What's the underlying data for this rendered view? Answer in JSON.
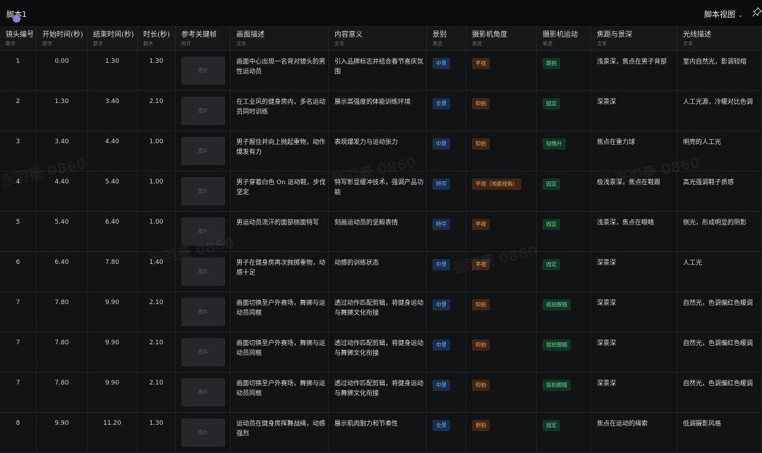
{
  "app": {
    "doc_title": "脚本1",
    "view_label": "脚本视图"
  },
  "columns": [
    {
      "label": "镜头编号",
      "type": "数字"
    },
    {
      "label": "开始时间(秒)",
      "type": "数字"
    },
    {
      "label": "结束时间(秒)",
      "type": "数字"
    },
    {
      "label": "时长(秒)",
      "type": "数字"
    },
    {
      "label": "参考关键帧",
      "type": "附件"
    },
    {
      "label": "画面描述",
      "type": "文本"
    },
    {
      "label": "内容意义",
      "type": "文本"
    },
    {
      "label": "景别",
      "type": "单选"
    },
    {
      "label": "摄影机角度",
      "type": "单选"
    },
    {
      "label": "摄影机运动",
      "type": "单选"
    },
    {
      "label": "焦距与景深",
      "type": "文本"
    },
    {
      "label": "光线描述",
      "type": "文本"
    }
  ],
  "thumb_label": "图片",
  "watermark": "张羽豪 0860",
  "rows": [
    {
      "shot": "1",
      "start": "0.00",
      "end": "1.30",
      "dur": "1.30",
      "desc": "画面中心出现一名背对镜头的男性运动员",
      "meaning": "引入品牌标志并结合春节喜庆氛围",
      "scene": "中景",
      "angle": "平视",
      "move": "跟拍",
      "focus": "浅景深，焦点在男子背部",
      "light": "室内自然光，影调较暗"
    },
    {
      "shot": "2",
      "start": "1.30",
      "end": "3.40",
      "dur": "2.10",
      "desc": "在工业风的健身房内，多名运动员同时训练",
      "meaning": "展示高强度的体能训练环境",
      "scene": "全景",
      "angle": "仰拍",
      "move": "固定",
      "focus": "深景深",
      "light": "人工光源，冷暖对比色调"
    },
    {
      "shot": "3",
      "start": "3.40",
      "end": "4.40",
      "dur": "1.00",
      "desc": "男子握住并向上抛起重物，动作爆发有力",
      "meaning": "表现爆发力与运动张力",
      "scene": "中景",
      "angle": "仰拍",
      "move": "轻微升",
      "focus": "焦点在重力球",
      "light": "明亮的人工光"
    },
    {
      "shot": "4",
      "start": "4.40",
      "end": "5.40",
      "dur": "1.00",
      "desc": "男子穿着白色 On 运动鞋，步伐坚定",
      "meaning": "特写彰显缓冲技术，强调产品功能",
      "scene": "特写",
      "angle": "平视（地面视角）",
      "move": "固定",
      "focus": "极浅景深，焦点在鞋跟",
      "light": "高光强调鞋子质感"
    },
    {
      "shot": "5",
      "start": "5.40",
      "end": "6.40",
      "dur": "1.00",
      "desc": "男运动员流汗的面部侧面特写",
      "meaning": "刻画运动员的坚毅表情",
      "scene": "特写",
      "angle": "平视",
      "move": "固定",
      "focus": "浅景深，焦点在眼睛",
      "light": "侧光，形成明显的阴影"
    },
    {
      "shot": "6",
      "start": "6.40",
      "end": "7.80",
      "dur": "1.40",
      "desc": "男子在健身房再次抛掷重物，动感十足",
      "meaning": "动感的训练状态",
      "scene": "中景",
      "angle": "平视",
      "move": "固定",
      "focus": "深景深",
      "light": "人工光"
    },
    {
      "shot": "7",
      "start": "7.80",
      "end": "9.90",
      "dur": "2.10",
      "desc": "画面切换至户外赛场，舞狮与运动员同框",
      "meaning": "透过动作匹配剪辑，将健身运动与舞狮文化衔接",
      "scene": "中景",
      "angle": "仰拍",
      "move": "摇拍跟随",
      "focus": "深景深",
      "light": "自然光，色调偏红色暖调"
    },
    {
      "shot": "7",
      "start": "7.80",
      "end": "9.90",
      "dur": "2.10",
      "desc": "画面切换至户外赛场，舞狮与运动员同框",
      "meaning": "透过动作匹配剪辑，将健身运动与舞狮文化衔接",
      "scene": "中景",
      "angle": "仰拍",
      "move": "摇拍跟随",
      "focus": "深景深",
      "light": "自然光，色调偏红色暖调"
    },
    {
      "shot": "7",
      "start": "7.80",
      "end": "9.90",
      "dur": "2.10",
      "desc": "画面切换至户外赛场，舞狮与运动员同框",
      "meaning": "透过动作匹配剪辑，将健身运动与舞狮文化衔接",
      "scene": "中景",
      "angle": "仰拍",
      "move": "摇拍跟随",
      "focus": "深景深",
      "light": "自然光，色调偏红色暖调"
    },
    {
      "shot": "8",
      "start": "9.90",
      "end": "11.20",
      "dur": "1.30",
      "desc": "运动员在健身房挥舞战绳，动感强烈",
      "meaning": "展示肌肉耐力和节奏性",
      "scene": "全景",
      "angle": "俯拍",
      "move": "固定",
      "focus": "焦点在运动的绳索",
      "light": "低调摄影风格"
    }
  ],
  "colors": {
    "scene_tag": "#7bb2ee",
    "angle_tag": "#e8a467",
    "move_tag": "#6fd49c",
    "accent": "#9b7bd8"
  }
}
